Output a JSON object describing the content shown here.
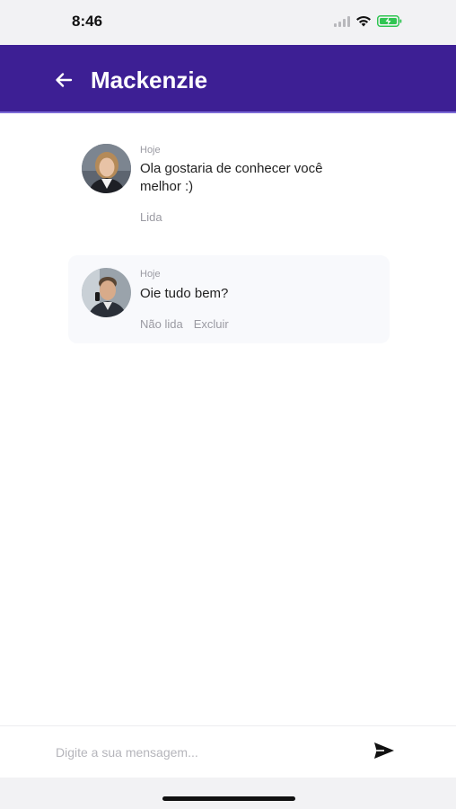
{
  "status_bar": {
    "time": "8:46",
    "icons": [
      "signal-icon",
      "wifi-icon",
      "battery-charging-icon"
    ]
  },
  "header": {
    "title": "Mackenzie",
    "back_icon": "arrow-left-icon",
    "background": "#3d1f94"
  },
  "messages": [
    {
      "day": "Hoje",
      "text": "Ola gostaria de conhecer você melhor :)",
      "status": "Lida",
      "avatar": "woman-avatar"
    },
    {
      "day": "Hoje",
      "text": "Oie tudo bem?",
      "status": "Não lida",
      "delete_label": "Excluir",
      "avatar": "man-avatar"
    }
  ],
  "composer": {
    "placeholder": "Digite a sua mensagem...",
    "value": "",
    "send_icon": "send-icon"
  }
}
